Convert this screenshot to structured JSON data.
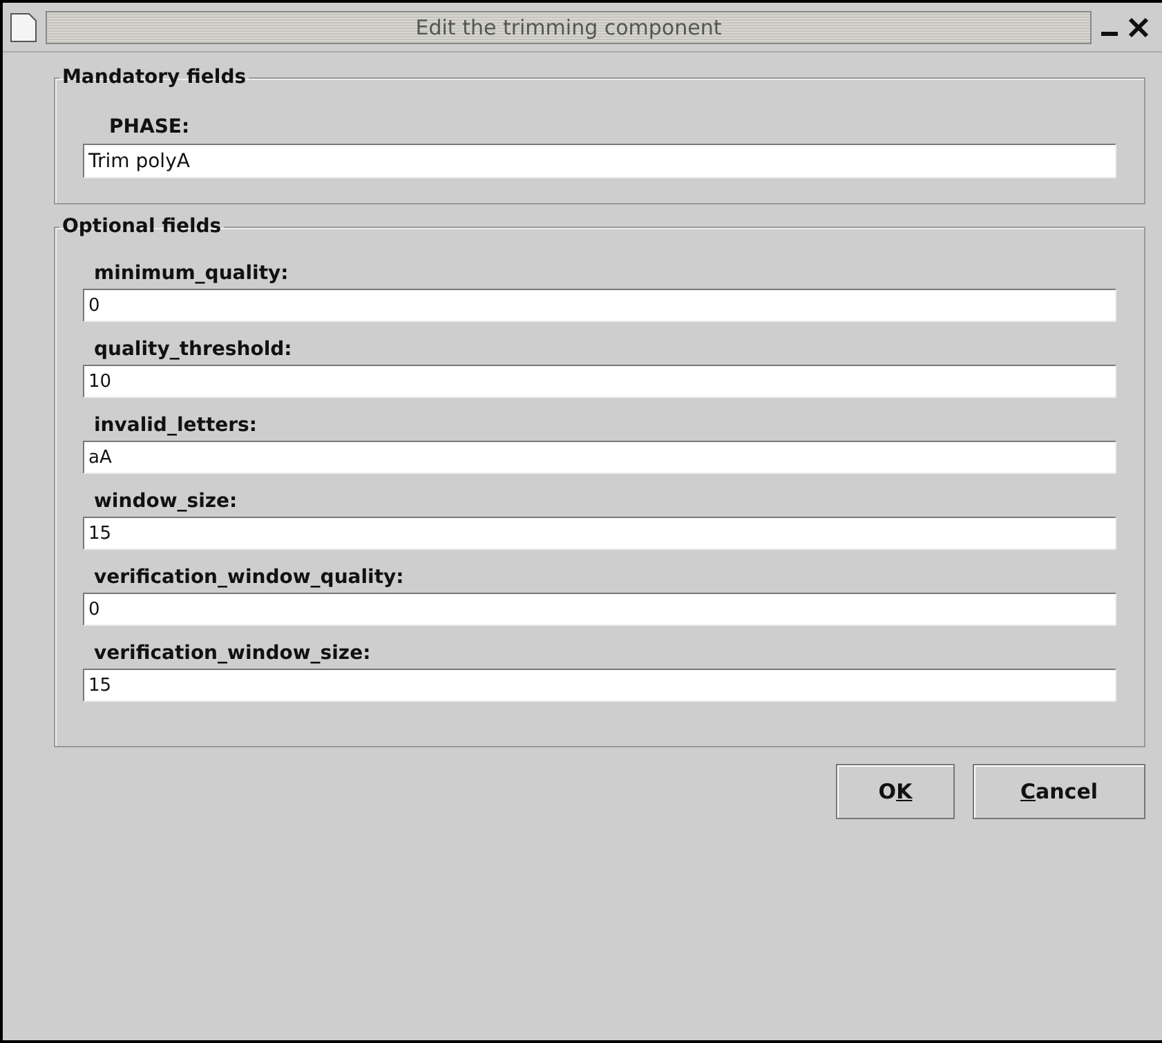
{
  "window": {
    "title": "Edit the trimming component"
  },
  "groups": [
    {
      "title": "Mandatory fields",
      "kind": "mandatory",
      "fields": [
        {
          "label": "PHASE:",
          "value": "Trim polyA"
        }
      ]
    },
    {
      "title": "Optional fields",
      "kind": "optional",
      "fields": [
        {
          "label": "minimum_quality:",
          "value": "0"
        },
        {
          "label": "quality_threshold:",
          "value": "10"
        },
        {
          "label": "invalid_letters:",
          "value": "aA"
        },
        {
          "label": "window_size:",
          "value": "15"
        },
        {
          "label": "verification_window_quality:",
          "value": "0"
        },
        {
          "label": "verification_window_size:",
          "value": "15"
        }
      ]
    }
  ],
  "buttons": [
    {
      "before": "O",
      "key": "K"
    },
    {
      "key": "C",
      "after": "ancel"
    }
  ]
}
